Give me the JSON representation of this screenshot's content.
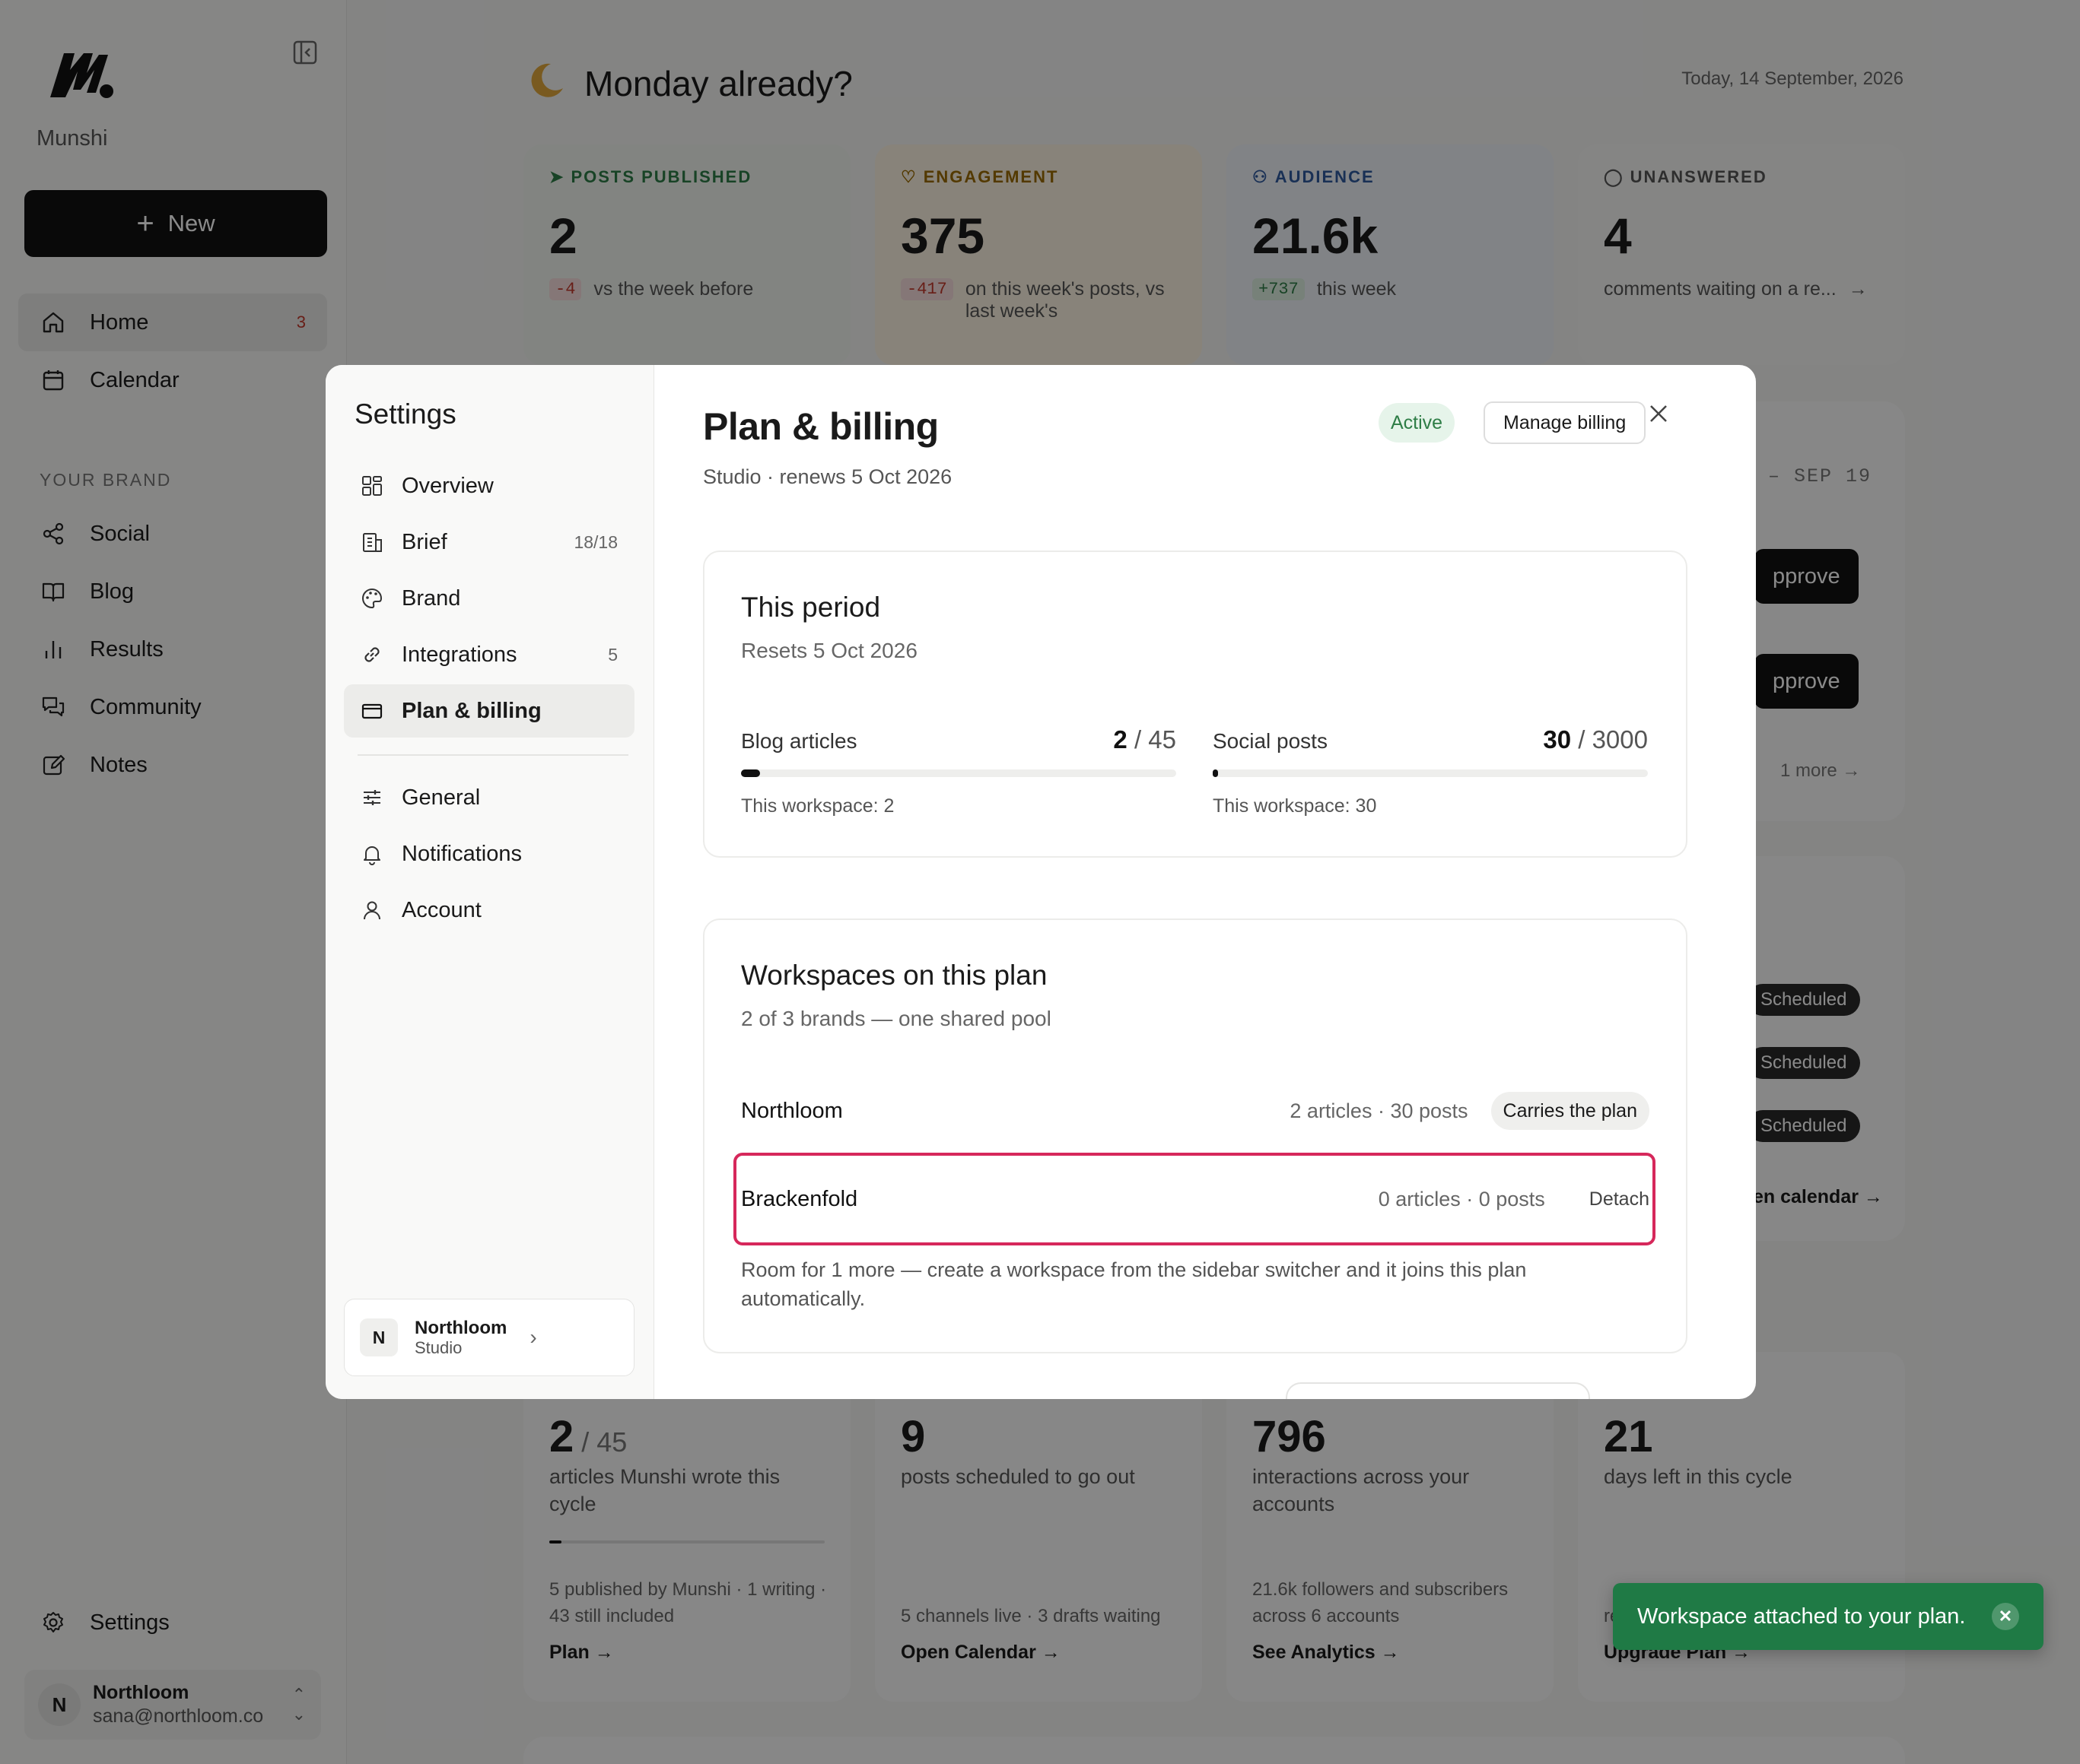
{
  "sidebar": {
    "brand_name": "Munshi",
    "new_label": "New",
    "nav": [
      {
        "label": "Home",
        "badge": "3"
      },
      {
        "label": "Calendar"
      }
    ],
    "section_label": "YOUR BRAND",
    "brand_nav": [
      {
        "label": "Social"
      },
      {
        "label": "Blog"
      },
      {
        "label": "Results"
      },
      {
        "label": "Community"
      },
      {
        "label": "Notes"
      }
    ],
    "settings_label": "Settings",
    "user": {
      "initial": "N",
      "name": "Northloom",
      "email": "sana@northloom.co"
    }
  },
  "dashboard": {
    "greeting": "Monday already?",
    "date": "Today, 14 September, 2026",
    "stats": [
      {
        "label": "POSTS PUBLISHED",
        "value": "2",
        "delta": "-4",
        "text": "vs the week before",
        "color": "#2e7d46"
      },
      {
        "label": "ENGAGEMENT",
        "value": "375",
        "delta": "-417",
        "text": "on this week's posts, vs last week's",
        "color": "#9a6a00"
      },
      {
        "label": "AUDIENCE",
        "value": "21.6k",
        "delta": "+737",
        "text": "this week",
        "color": "#2f5a9e"
      },
      {
        "label": "UNANSWERED",
        "value": "4",
        "text": "comments waiting on a re...",
        "color": "#555555"
      }
    ],
    "week_range": "– SEP 19",
    "approve_label": "pprove",
    "more_label": "1 more",
    "scheduled_label": "Scheduled",
    "calendar_link": "en calendar →",
    "bottom_cards": [
      {
        "value": "2",
        "of": " / 45",
        "desc": "articles Munshi wrote this cycle",
        "foot": "5 published by Munshi · 1 writing · 43 still included",
        "link": "Plan →",
        "progress": 0.044
      },
      {
        "value": "9",
        "desc": "posts scheduled to go out",
        "foot": "5 channels live · 3 drafts waiting",
        "link": "Open Calendar →"
      },
      {
        "value": "796",
        "desc": "interactions across your accounts",
        "foot": "21.6k followers and subscribers across 6 accounts",
        "link": "See Analytics →"
      },
      {
        "value": "21",
        "desc": "days left in this cycle",
        "foot": "re",
        "link": "Upgrade Plan →"
      }
    ]
  },
  "settings": {
    "title": "Settings",
    "items": [
      {
        "label": "Overview"
      },
      {
        "label": "Brief",
        "count": "18/18"
      },
      {
        "label": "Brand"
      },
      {
        "label": "Integrations",
        "count": "5"
      },
      {
        "label": "Plan & billing"
      },
      {
        "label": "General"
      },
      {
        "label": "Notifications"
      },
      {
        "label": "Account"
      }
    ],
    "workspace": {
      "initial": "N",
      "name": "Northloom",
      "plan": "Studio"
    }
  },
  "plan": {
    "title": "Plan & billing",
    "subtitle": "Studio · renews 5 Oct 2026",
    "status": "Active",
    "manage_label": "Manage billing",
    "period": {
      "title": "This period",
      "subtitle": "Resets 5 Oct 2026",
      "meters": [
        {
          "name": "Blog articles",
          "used": "2",
          "limit": " / 45",
          "workspace": "This workspace: 2",
          "fraction": 0.044
        },
        {
          "name": "Social posts",
          "used": "30",
          "limit": " / 3000",
          "workspace": "This workspace: 30",
          "fraction": 0.01
        }
      ]
    },
    "workspaces": {
      "title": "Workspaces on this plan",
      "subtitle": "2 of 3 brands — one shared pool",
      "rows": [
        {
          "name": "Northloom",
          "stats": "2 articles · 30 posts",
          "tag": "Carries the plan"
        },
        {
          "name": "Brackenfold",
          "stats": "0 articles · 0 posts",
          "action": "Detach"
        }
      ],
      "note": "Room for 1 more — create a workspace from the sidebar switcher and it joins this plan automatically."
    }
  },
  "toast": {
    "message": "Workspace attached to your plan."
  }
}
